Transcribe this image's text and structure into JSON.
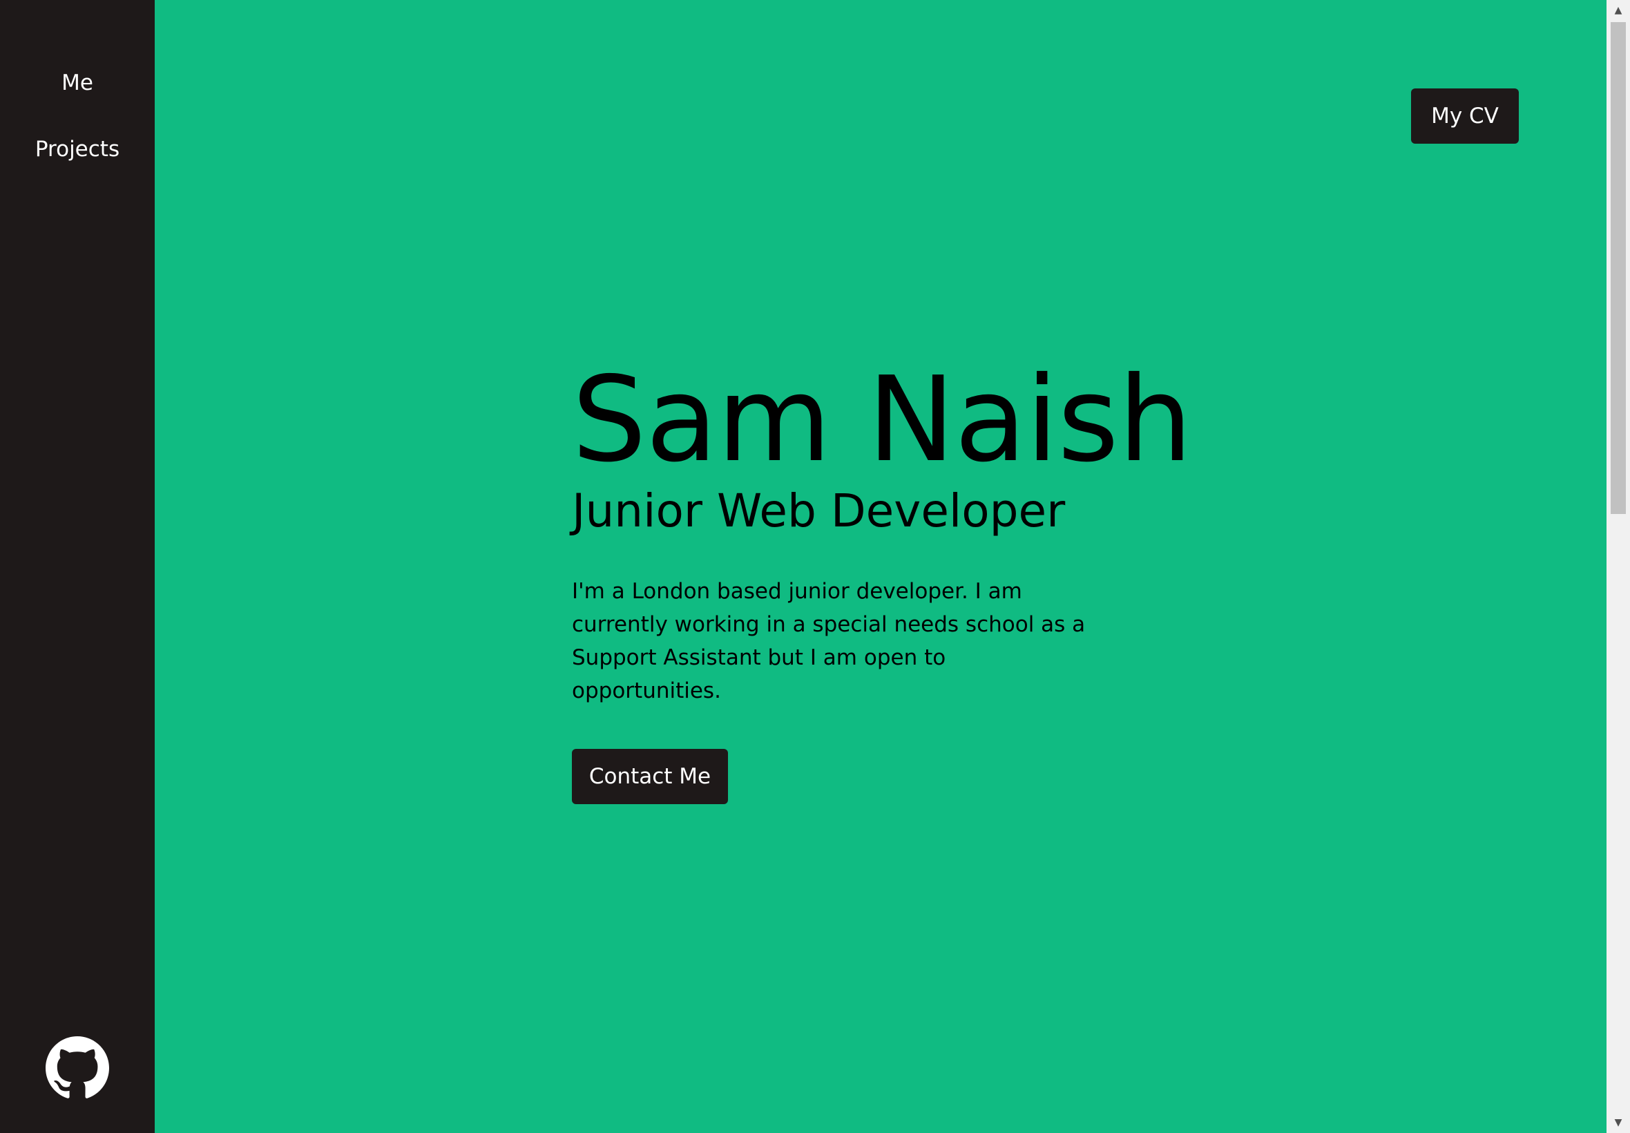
{
  "sidebar": {
    "nav": {
      "me_label": "Me",
      "projects_label": "Projects"
    },
    "github_icon": "github-icon"
  },
  "header": {
    "cv_button_label": "My CV"
  },
  "hero": {
    "name": "Sam Naish",
    "role": "Junior Web Developer",
    "bio": "I'm a London based junior developer. I am currently working in a special needs school as a Support Assistant but I am open to opportunities.",
    "contact_button_label": "Contact Me"
  },
  "scrollbar": {
    "up_icon": "▲",
    "down_icon": "▼"
  },
  "colors": {
    "page_background": "#10bb82",
    "sidebar_background": "#1e1919",
    "button_background": "#1e1919",
    "button_text": "#ffffff",
    "hero_text": "#000000"
  }
}
